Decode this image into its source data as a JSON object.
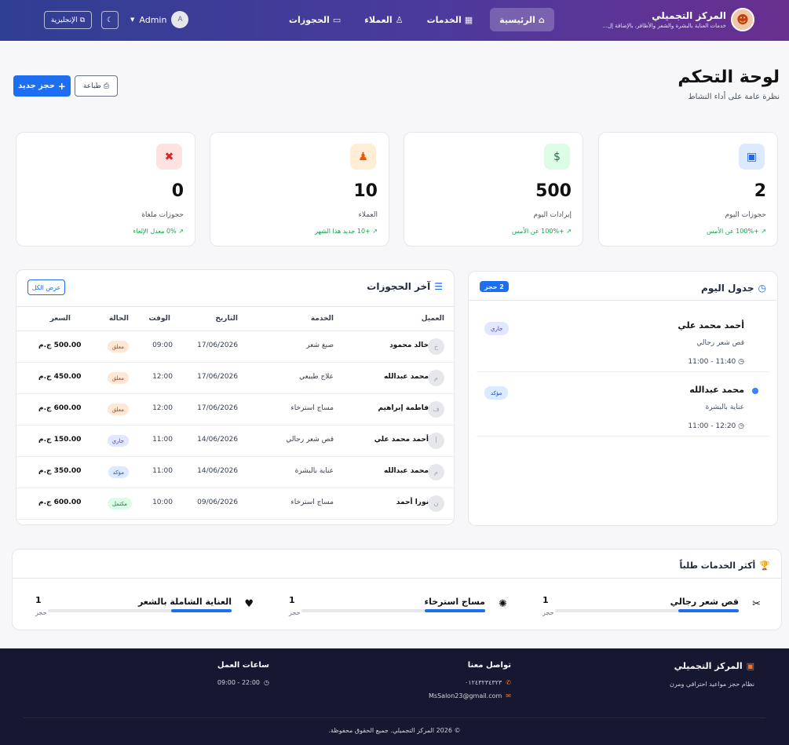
{
  "nav": {
    "brand_name": "المركز التجميلي",
    "brand_desc": "خدمات العناية بالبشرة والشعر والأظافر، بالإضافة إل...",
    "links": [
      {
        "label": "الرئيسية",
        "icon": "⌂"
      },
      {
        "label": "الخدمات",
        "icon": "▦"
      },
      {
        "label": "العملاء",
        "icon": "♙"
      },
      {
        "label": "الحجوزات",
        "icon": "▭"
      }
    ],
    "user": "Admin",
    "user_initial": "A",
    "lang_label": "الإنجليزية",
    "theme_icon": "☾"
  },
  "header": {
    "title": "لوحة التحكم",
    "subtitle": "نظرة عامة على أداء النشاط",
    "new_booking": "حجز جديد",
    "print": "طباعة"
  },
  "stats": [
    {
      "value": "2",
      "label": "حجوزات اليوم",
      "trend": "+100% عن الأمس",
      "icon": "calendar-icon",
      "color": "#2563eb",
      "bg": "#dbeafe"
    },
    {
      "value": "500",
      "label": "إيرادات اليوم",
      "trend": "+100% عن الأمس",
      "icon": "money-icon",
      "color": "#15803d",
      "bg": "#dcfce7"
    },
    {
      "value": "10",
      "label": "العملاء",
      "trend": "+10 جديد هذا الشهر",
      "icon": "users-icon",
      "color": "#ea580c",
      "bg": "#ffedd5"
    },
    {
      "value": "0",
      "label": "حجوزات ملغاة",
      "trend": "0% معدل الإلغاء",
      "icon": "cancel-icon",
      "color": "#dc2626",
      "bg": "#fee2e2"
    }
  ],
  "schedule": {
    "title": "جدول اليوم",
    "count": "2 حجز",
    "items": [
      {
        "name": "أحمد محمد علي",
        "service": "قص شعر رجالي",
        "time": "11:40 - 11:00",
        "status": "جاري"
      },
      {
        "name": "محمد عبدالله",
        "service": "عناية بالبشرة",
        "time": "12:20 - 11:00",
        "status": "مؤكد"
      }
    ]
  },
  "recent": {
    "title": "آخر الحجوزات",
    "view_all": "عرض الكل",
    "columns": [
      "العميل",
      "الخدمة",
      "التاريخ",
      "الوقت",
      "الحالة",
      "السعر"
    ],
    "rows": [
      {
        "initial": "خ",
        "client": "خالد محمود",
        "service": "صبغ شعر",
        "date": "17/06/2026",
        "time": "09:00",
        "status": "معلق",
        "price": "500.00 ج.م"
      },
      {
        "initial": "م",
        "client": "محمد عبدالله",
        "service": "علاج طبيعي",
        "date": "17/06/2026",
        "time": "12:00",
        "status": "معلق",
        "price": "450.00 ج.م"
      },
      {
        "initial": "ف",
        "client": "فاطمة إبراهيم",
        "service": "مساج استرخاء",
        "date": "17/06/2026",
        "time": "12:00",
        "status": "معلق",
        "price": "600.00 ج.م"
      },
      {
        "initial": "أ",
        "client": "أحمد محمد علي",
        "service": "قص شعر رجالي",
        "date": "14/06/2026",
        "time": "11:00",
        "status": "جاري",
        "price": "150.00 ج.م"
      },
      {
        "initial": "م",
        "client": "محمد عبدالله",
        "service": "عناية بالبشرة",
        "date": "14/06/2026",
        "time": "11:00",
        "status": "مؤكد",
        "price": "350.00 ج.م"
      },
      {
        "initial": "ن",
        "client": "نورا أحمد",
        "service": "مساج استرخاء",
        "date": "09/06/2026",
        "time": "10:00",
        "status": "مكتمل",
        "price": "600.00 ج.م"
      }
    ]
  },
  "top_services": {
    "title": "أكثر الخدمات طلباً",
    "items": [
      {
        "name": "قص شعر رجالي",
        "count": "1",
        "unit": "حجز",
        "icon": "scissors-icon",
        "share": 0.33
      },
      {
        "name": "مساج استرخاء",
        "count": "1",
        "unit": "حجز",
        "icon": "spa-icon",
        "share": 0.33
      },
      {
        "name": "العناية الشاملة بالشعر",
        "count": "1",
        "unit": "حجز",
        "icon": "heart-icon",
        "share": 0.33
      }
    ]
  },
  "footer": {
    "brand": "المركز التجميلي",
    "brand_desc": "نظام حجز مواعيد احترافي ومرن",
    "contact_title": "تواصل معنا",
    "phone": "٠١٢٤٣٢٣٤٣٢٣",
    "email": "MsSalon23@gmail.com",
    "hours_title": "ساعات العمل",
    "hours": "22:00 - 09:00",
    "copyright": "© 2026 المركز التجميلي. جميع الحقوق محفوظة."
  }
}
